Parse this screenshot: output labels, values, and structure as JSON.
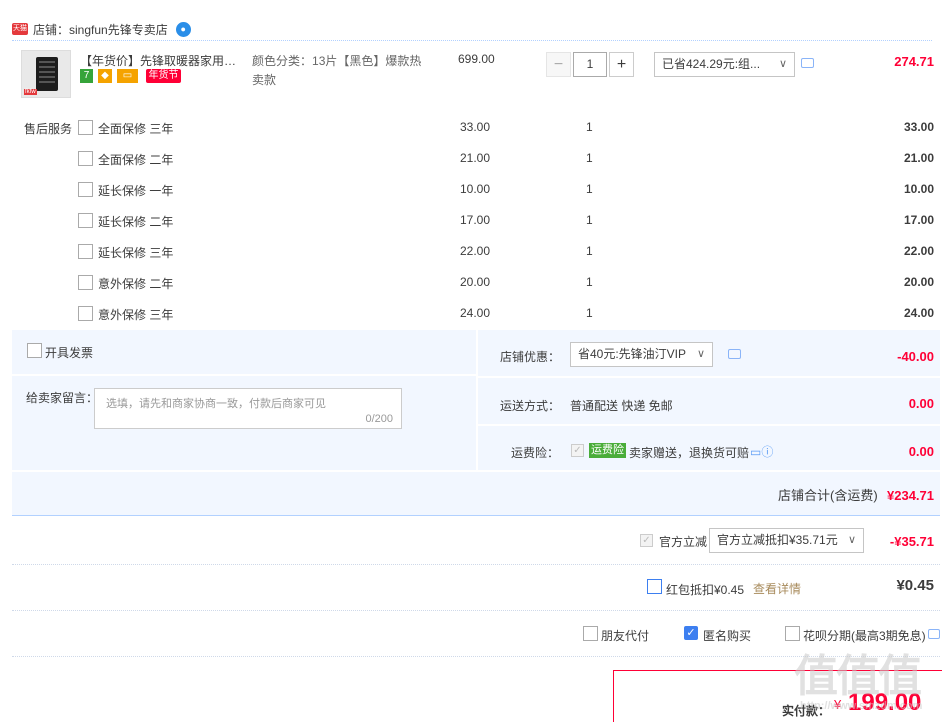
{
  "shop": {
    "tmall_badge": "天猫",
    "label": "店铺：",
    "name": "singfun先锋专卖店"
  },
  "item": {
    "title": "【年货价】先锋取暖器家用电暖...",
    "tags": [
      "7",
      "年货节"
    ],
    "sku_label": "颜色分类：",
    "sku_value": "13片【黑色】爆款热卖款",
    "price": "699.00",
    "quantity": "1",
    "promo": "已省424.29元:组...",
    "subtotal": "274.71",
    "img_badge": "fkfw"
  },
  "services": {
    "label": "售后服务",
    "rows": [
      {
        "name": "全面保修 三年",
        "price": "33.00",
        "qty": "1",
        "sub": "33.00"
      },
      {
        "name": "全面保修 二年",
        "price": "21.00",
        "qty": "1",
        "sub": "21.00"
      },
      {
        "name": "延长保修 一年",
        "price": "10.00",
        "qty": "1",
        "sub": "10.00"
      },
      {
        "name": "延长保修 二年",
        "price": "17.00",
        "qty": "1",
        "sub": "17.00"
      },
      {
        "name": "延长保修 三年",
        "price": "22.00",
        "qty": "1",
        "sub": "22.00"
      },
      {
        "name": "意外保修 二年",
        "price": "20.00",
        "qty": "1",
        "sub": "20.00"
      },
      {
        "name": "意外保修 三年",
        "price": "24.00",
        "qty": "1",
        "sub": "24.00"
      }
    ]
  },
  "invoice": {
    "label": "开具发票"
  },
  "message": {
    "label": "给卖家留言：",
    "placeholder": "选填，请先和商家协商一致，付款后商家可见",
    "counter": "0/200"
  },
  "store_coupon": {
    "label": "店铺优惠：",
    "value": "省40元:先锋油汀VIP",
    "amount": "-40.00"
  },
  "shipping": {
    "label": "运送方式：",
    "value": "普通配送 快递 免邮",
    "amount": "0.00"
  },
  "insurance": {
    "label": "运费险：",
    "tag": "运费险",
    "desc": "卖家赠送，退换货可赔",
    "amount": "0.00"
  },
  "store_total": {
    "label": "店铺合计(含运费)",
    "amount": "¥234.71"
  },
  "official": {
    "label": "官方立减",
    "value": "官方立减抵扣¥35.71元",
    "amount": "-¥35.71"
  },
  "redpacket": {
    "label": "红包抵扣¥0.45",
    "link": "查看详情",
    "amount": "¥0.45"
  },
  "options": {
    "friend_pay": "朋友代付",
    "anonymous": "匿名购买",
    "huabei": "花呗分期(最高3期免息)"
  },
  "payment": {
    "label": "实付款：",
    "amount": "199.00",
    "currency": "¥"
  },
  "watermark": {
    "text": "值值值",
    "sub": "http://www.smzdm.com"
  },
  "colors": {
    "accent_red": "#ff0036",
    "panel_bg": "#f2f7ff",
    "link_blue": "#3d7ff0"
  }
}
